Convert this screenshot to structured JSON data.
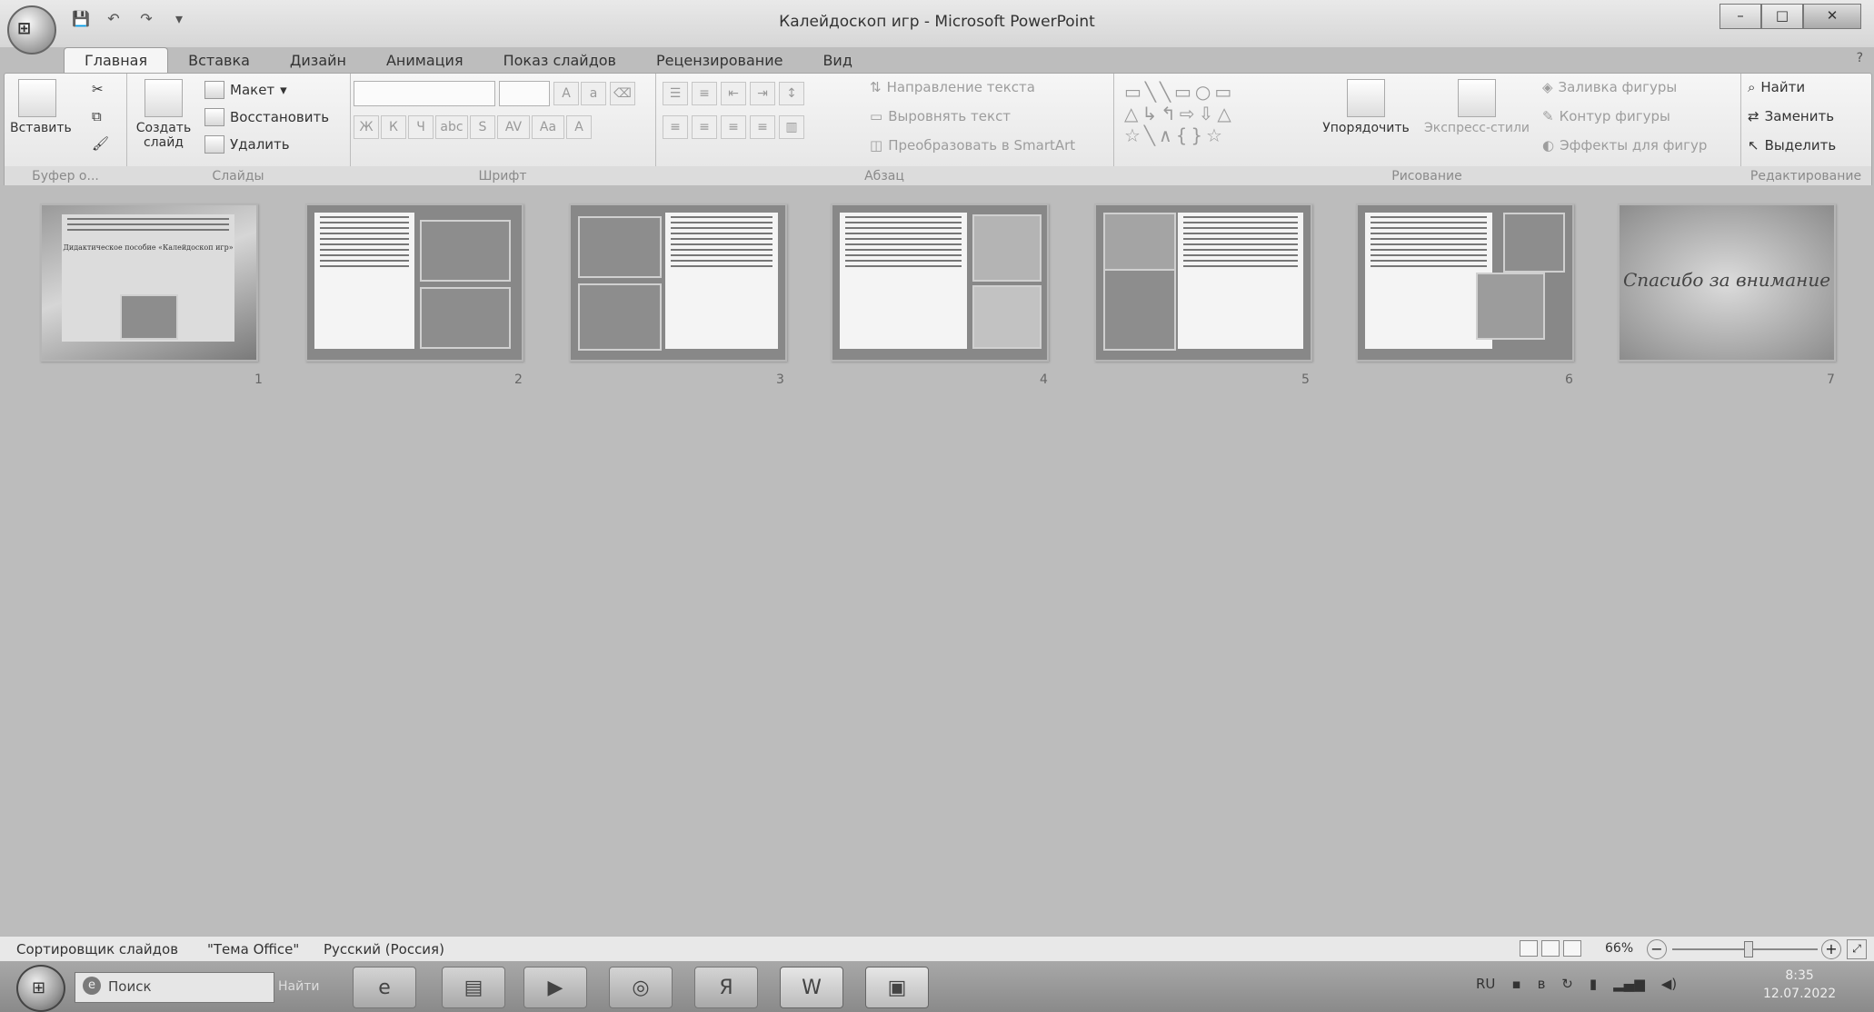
{
  "app": {
    "window_title": "Калейдоскоп игр - Microsoft PowerPoint",
    "office_button": "Office",
    "qat": {
      "save_icon": "save-icon",
      "undo_icon": "undo-icon",
      "redo_icon": "redo-icon",
      "customize_icon": "chevron-down-icon"
    },
    "window_controls": {
      "minimize": "–",
      "maximize": "□",
      "close": "✕"
    },
    "help": "?"
  },
  "tabs": [
    "Главная",
    "Вставка",
    "Дизайн",
    "Анимация",
    "Показ слайдов",
    "Рецензирование",
    "Вид"
  ],
  "active_tab": "Главная",
  "ribbon": {
    "clipboard": {
      "paste": "Вставить",
      "label": "Буфер о..."
    },
    "slides": {
      "new_slide": "Создать слайд",
      "layout": "Макет",
      "reset": "Восстановить",
      "delete": "Удалить",
      "label": "Слайды"
    },
    "font": {
      "label": "Шрифт",
      "bold": "Ж",
      "italic": "К",
      "underline": "Ч",
      "strike": "abc",
      "shadow": "S",
      "spacing": "AV",
      "case": "Aa",
      "color": "A"
    },
    "paragraph": {
      "text_direction": "Направление текста",
      "align_text": "Выровнять текст",
      "convert_smartart": "Преобразовать в SmartArt",
      "label": "Абзац"
    },
    "drawing": {
      "arrange": "Упорядочить",
      "quick_styles": "Экспресс-стили",
      "shape_fill": "Заливка фигуры",
      "shape_outline": "Контур фигуры",
      "shape_effects": "Эффекты для фигур",
      "label": "Рисование"
    },
    "editing": {
      "find": "Найти",
      "replace": "Заменить",
      "select": "Выделить",
      "label": "Редактирование"
    }
  },
  "slides": [
    {
      "number": "1",
      "title_text": "Дидактическое пособие «Калейдоскоп игр»"
    },
    {
      "number": "2"
    },
    {
      "number": "3"
    },
    {
      "number": "4"
    },
    {
      "number": "5"
    },
    {
      "number": "6"
    },
    {
      "number": "7",
      "closing_text": "Спасибо за внимание"
    }
  ],
  "status": {
    "view": "Сортировщик слайдов",
    "theme": "\"Тема Office\"",
    "language": "Русский (Россия)",
    "zoom": "66%",
    "zoom_fraction": 0.52
  },
  "taskbar": {
    "search_placeholder": "Поиск",
    "search_button": "Найти",
    "apps": [
      "ie-icon",
      "explorer-icon",
      "media-player-icon",
      "chrome-icon",
      "yandex-icon",
      "word-icon",
      "powerpoint-icon"
    ],
    "yandex_letter": "Я",
    "word_letter": "W",
    "tray_lang": "RU",
    "clock_time": "8:35",
    "clock_date": "12.07.2022"
  }
}
